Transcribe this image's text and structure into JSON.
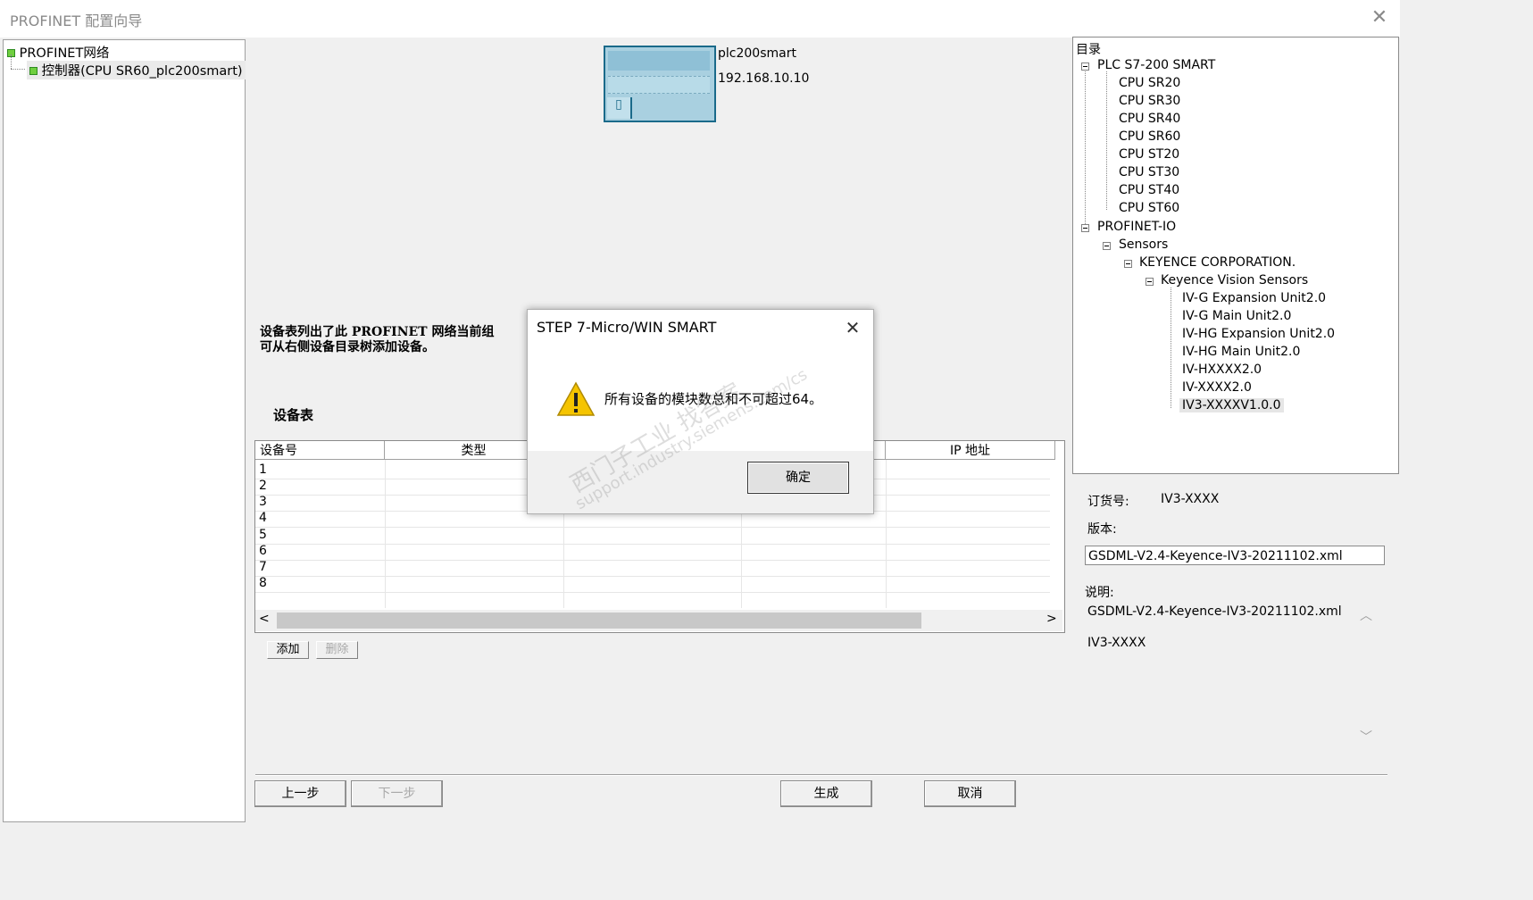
{
  "window": {
    "title": "PROFINET 配置向导",
    "close_glyph": "✕"
  },
  "left_tree": {
    "root_label": "PROFINET网络",
    "controller_label": "控制器(CPU SR60_plc200smart)"
  },
  "plc": {
    "name": "plc200smart",
    "ip": "192.168.10.10"
  },
  "description": {
    "line1": "设备表列出了此 PROFINET 网络当前组",
    "line2": "可从右侧设备目录树添加设备。"
  },
  "device_table": {
    "label": "设备表",
    "columns": [
      "设备号",
      "类型",
      "",
      "",
      "IP 地址"
    ],
    "rows": [
      "1",
      "2",
      "3",
      "4",
      "5",
      "6",
      "7",
      "8"
    ],
    "scroll_left": "<",
    "scroll_right": ">"
  },
  "table_buttons": {
    "add": "添加",
    "delete": "删除"
  },
  "nav_buttons": {
    "prev": "上一步",
    "next": "下一步",
    "generate": "生成",
    "cancel": "取消"
  },
  "catalog": {
    "title": "目录",
    "plc_group": "PLC S7-200 SMART",
    "cpus": [
      "CPU SR20",
      "CPU SR30",
      "CPU SR40",
      "CPU SR60",
      "CPU ST20",
      "CPU ST30",
      "CPU ST40",
      "CPU ST60"
    ],
    "profinet_io": "PROFINET-IO",
    "sensors": "Sensors",
    "vendor": "KEYENCE CORPORATION.",
    "family": "Keyence Vision Sensors",
    "devices": [
      "IV-G Expansion Unit2.0",
      "IV-G Main Unit2.0",
      "IV-HG Expansion Unit2.0",
      "IV-HG Main Unit2.0",
      "IV-HXXXX2.0",
      "IV-XXXX2.0",
      "IV3-XXXXV1.0.0"
    ]
  },
  "info": {
    "order_label": "订货号:",
    "order_value": "IV3-XXXX",
    "version_label": "版本:",
    "version_value": "GSDML-V2.4-Keyence-IV3-20211102.xml",
    "desc_label": "说明:",
    "desc_line1": "GSDML-V2.4-Keyence-IV3-20211102.xml",
    "desc_line2": "IV3-XXXX"
  },
  "dialog": {
    "title": "STEP 7-Micro/WIN SMART",
    "message": "所有设备的模块数总和不可超过64。",
    "ok": "确定",
    "close_glyph": "✕"
  },
  "watermark": {
    "line1": "西门子工业  找答案",
    "line2": "support.industry.siemens.com/cs"
  },
  "colors": {
    "accent_tree_icon": "#6fcf3f",
    "plc_frame": "#1a6a8a",
    "warning": "#f5c400"
  }
}
